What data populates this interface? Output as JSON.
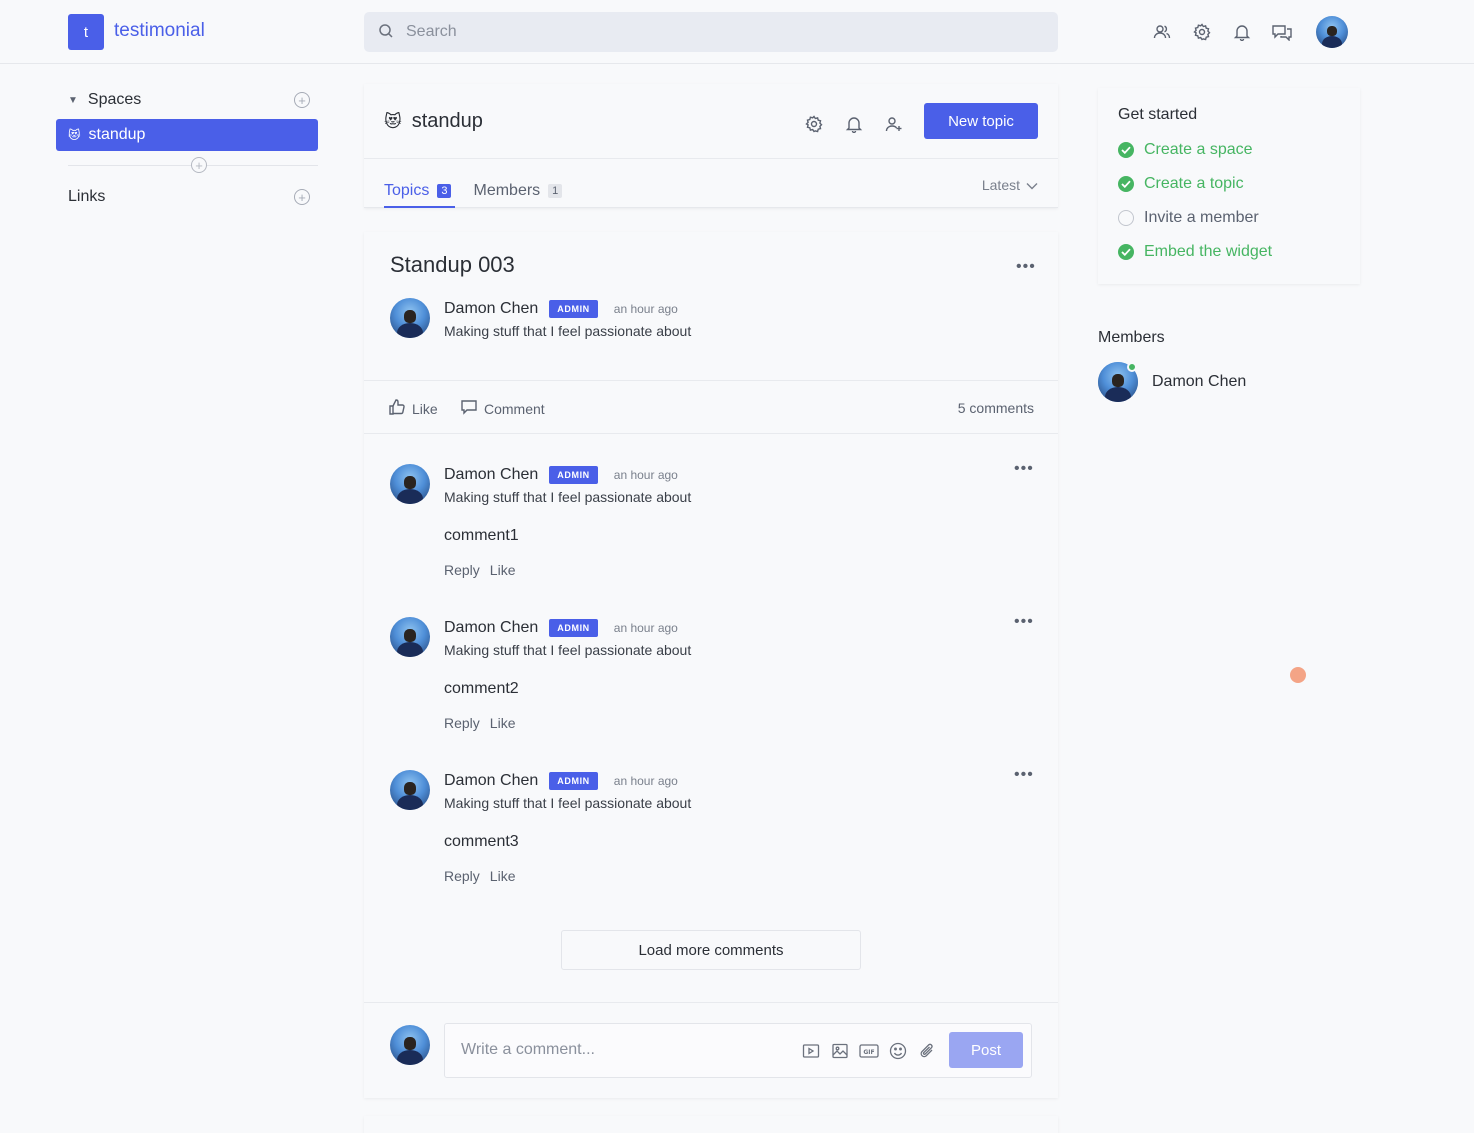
{
  "app": {
    "logo_letter": "t",
    "name": "testimonial"
  },
  "search": {
    "placeholder": "Search"
  },
  "top_icons": [
    "members-icon",
    "gear-icon",
    "bell-icon",
    "chat-icon"
  ],
  "sidebar": {
    "spaces_label": "Spaces",
    "spaces": [
      {
        "emoji": "😻",
        "label": "standup"
      }
    ],
    "links_label": "Links"
  },
  "space": {
    "emoji": "😻",
    "name": "standup",
    "new_topic_label": "New topic",
    "tabs": [
      {
        "label": "Topics",
        "count": "3"
      },
      {
        "label": "Members",
        "count": "1"
      }
    ],
    "sort_label": "Latest"
  },
  "topic": {
    "title": "Standup 003",
    "author": "Damon Chen",
    "badge": "ADMIN",
    "time": "an hour ago",
    "bio": "Making stuff that I feel passionate about",
    "like_label": "Like",
    "comment_label": "Comment",
    "comments_count": "5 comments"
  },
  "comments": [
    {
      "author": "Damon Chen",
      "badge": "ADMIN",
      "time": "an hour ago",
      "bio": "Making stuff that I feel passionate about",
      "text": "comment1",
      "reply_label": "Reply",
      "like_label": "Like"
    },
    {
      "author": "Damon Chen",
      "badge": "ADMIN",
      "time": "an hour ago",
      "bio": "Making stuff that I feel passionate about",
      "text": "comment2",
      "reply_label": "Reply",
      "like_label": "Like"
    },
    {
      "author": "Damon Chen",
      "badge": "ADMIN",
      "time": "an hour ago",
      "bio": "Making stuff that I feel passionate about",
      "text": "comment3",
      "reply_label": "Reply",
      "like_label": "Like"
    }
  ],
  "load_more_label": "Load more comments",
  "composer": {
    "placeholder": "Write a comment...",
    "post_label": "Post"
  },
  "get_started": {
    "title": "Get started",
    "items": [
      {
        "label": "Create a space",
        "done": true
      },
      {
        "label": "Create a topic",
        "done": true
      },
      {
        "label": "Invite a member",
        "done": false
      },
      {
        "label": "Embed the widget",
        "done": true
      }
    ]
  },
  "members": {
    "title": "Members",
    "list": [
      {
        "name": "Damon Chen",
        "online": true
      }
    ]
  },
  "colors": {
    "accent": "#4a5fe8",
    "success": "#46b562",
    "post_disabled": "#9aa6f2"
  }
}
